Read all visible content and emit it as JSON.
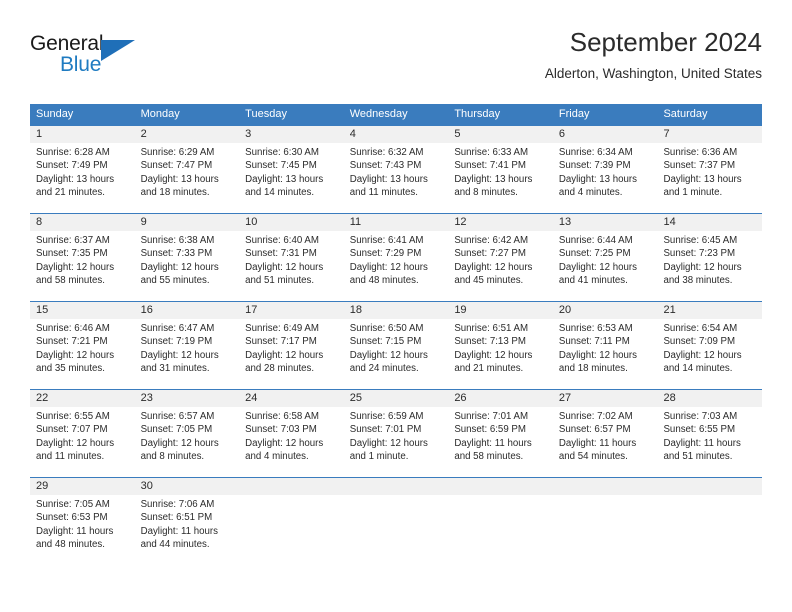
{
  "brand": {
    "name_part1": "General",
    "name_part2": "Blue",
    "flag_icon": "blue-triangle-flag-icon",
    "accent_color": "#1f6fb8"
  },
  "header": {
    "title": "September 2024",
    "location": "Alderton, Washington, United States"
  },
  "theme": {
    "header_blue": "#3a7cbe",
    "daynum_band": "#f1f1f1",
    "text": "#2b2b2b"
  },
  "calendar": {
    "weekdays": [
      "Sunday",
      "Monday",
      "Tuesday",
      "Wednesday",
      "Thursday",
      "Friday",
      "Saturday"
    ],
    "weeks": [
      [
        {
          "day": "1",
          "sunrise": "Sunrise: 6:28 AM",
          "sunset": "Sunset: 7:49 PM",
          "daylight1": "Daylight: 13 hours",
          "daylight2": "and 21 minutes."
        },
        {
          "day": "2",
          "sunrise": "Sunrise: 6:29 AM",
          "sunset": "Sunset: 7:47 PM",
          "daylight1": "Daylight: 13 hours",
          "daylight2": "and 18 minutes."
        },
        {
          "day": "3",
          "sunrise": "Sunrise: 6:30 AM",
          "sunset": "Sunset: 7:45 PM",
          "daylight1": "Daylight: 13 hours",
          "daylight2": "and 14 minutes."
        },
        {
          "day": "4",
          "sunrise": "Sunrise: 6:32 AM",
          "sunset": "Sunset: 7:43 PM",
          "daylight1": "Daylight: 13 hours",
          "daylight2": "and 11 minutes."
        },
        {
          "day": "5",
          "sunrise": "Sunrise: 6:33 AM",
          "sunset": "Sunset: 7:41 PM",
          "daylight1": "Daylight: 13 hours",
          "daylight2": "and 8 minutes."
        },
        {
          "day": "6",
          "sunrise": "Sunrise: 6:34 AM",
          "sunset": "Sunset: 7:39 PM",
          "daylight1": "Daylight: 13 hours",
          "daylight2": "and 4 minutes."
        },
        {
          "day": "7",
          "sunrise": "Sunrise: 6:36 AM",
          "sunset": "Sunset: 7:37 PM",
          "daylight1": "Daylight: 13 hours",
          "daylight2": "and 1 minute."
        }
      ],
      [
        {
          "day": "8",
          "sunrise": "Sunrise: 6:37 AM",
          "sunset": "Sunset: 7:35 PM",
          "daylight1": "Daylight: 12 hours",
          "daylight2": "and 58 minutes."
        },
        {
          "day": "9",
          "sunrise": "Sunrise: 6:38 AM",
          "sunset": "Sunset: 7:33 PM",
          "daylight1": "Daylight: 12 hours",
          "daylight2": "and 55 minutes."
        },
        {
          "day": "10",
          "sunrise": "Sunrise: 6:40 AM",
          "sunset": "Sunset: 7:31 PM",
          "daylight1": "Daylight: 12 hours",
          "daylight2": "and 51 minutes."
        },
        {
          "day": "11",
          "sunrise": "Sunrise: 6:41 AM",
          "sunset": "Sunset: 7:29 PM",
          "daylight1": "Daylight: 12 hours",
          "daylight2": "and 48 minutes."
        },
        {
          "day": "12",
          "sunrise": "Sunrise: 6:42 AM",
          "sunset": "Sunset: 7:27 PM",
          "daylight1": "Daylight: 12 hours",
          "daylight2": "and 45 minutes."
        },
        {
          "day": "13",
          "sunrise": "Sunrise: 6:44 AM",
          "sunset": "Sunset: 7:25 PM",
          "daylight1": "Daylight: 12 hours",
          "daylight2": "and 41 minutes."
        },
        {
          "day": "14",
          "sunrise": "Sunrise: 6:45 AM",
          "sunset": "Sunset: 7:23 PM",
          "daylight1": "Daylight: 12 hours",
          "daylight2": "and 38 minutes."
        }
      ],
      [
        {
          "day": "15",
          "sunrise": "Sunrise: 6:46 AM",
          "sunset": "Sunset: 7:21 PM",
          "daylight1": "Daylight: 12 hours",
          "daylight2": "and 35 minutes."
        },
        {
          "day": "16",
          "sunrise": "Sunrise: 6:47 AM",
          "sunset": "Sunset: 7:19 PM",
          "daylight1": "Daylight: 12 hours",
          "daylight2": "and 31 minutes."
        },
        {
          "day": "17",
          "sunrise": "Sunrise: 6:49 AM",
          "sunset": "Sunset: 7:17 PM",
          "daylight1": "Daylight: 12 hours",
          "daylight2": "and 28 minutes."
        },
        {
          "day": "18",
          "sunrise": "Sunrise: 6:50 AM",
          "sunset": "Sunset: 7:15 PM",
          "daylight1": "Daylight: 12 hours",
          "daylight2": "and 24 minutes."
        },
        {
          "day": "19",
          "sunrise": "Sunrise: 6:51 AM",
          "sunset": "Sunset: 7:13 PM",
          "daylight1": "Daylight: 12 hours",
          "daylight2": "and 21 minutes."
        },
        {
          "day": "20",
          "sunrise": "Sunrise: 6:53 AM",
          "sunset": "Sunset: 7:11 PM",
          "daylight1": "Daylight: 12 hours",
          "daylight2": "and 18 minutes."
        },
        {
          "day": "21",
          "sunrise": "Sunrise: 6:54 AM",
          "sunset": "Sunset: 7:09 PM",
          "daylight1": "Daylight: 12 hours",
          "daylight2": "and 14 minutes."
        }
      ],
      [
        {
          "day": "22",
          "sunrise": "Sunrise: 6:55 AM",
          "sunset": "Sunset: 7:07 PM",
          "daylight1": "Daylight: 12 hours",
          "daylight2": "and 11 minutes."
        },
        {
          "day": "23",
          "sunrise": "Sunrise: 6:57 AM",
          "sunset": "Sunset: 7:05 PM",
          "daylight1": "Daylight: 12 hours",
          "daylight2": "and 8 minutes."
        },
        {
          "day": "24",
          "sunrise": "Sunrise: 6:58 AM",
          "sunset": "Sunset: 7:03 PM",
          "daylight1": "Daylight: 12 hours",
          "daylight2": "and 4 minutes."
        },
        {
          "day": "25",
          "sunrise": "Sunrise: 6:59 AM",
          "sunset": "Sunset: 7:01 PM",
          "daylight1": "Daylight: 12 hours",
          "daylight2": "and 1 minute."
        },
        {
          "day": "26",
          "sunrise": "Sunrise: 7:01 AM",
          "sunset": "Sunset: 6:59 PM",
          "daylight1": "Daylight: 11 hours",
          "daylight2": "and 58 minutes."
        },
        {
          "day": "27",
          "sunrise": "Sunrise: 7:02 AM",
          "sunset": "Sunset: 6:57 PM",
          "daylight1": "Daylight: 11 hours",
          "daylight2": "and 54 minutes."
        },
        {
          "day": "28",
          "sunrise": "Sunrise: 7:03 AM",
          "sunset": "Sunset: 6:55 PM",
          "daylight1": "Daylight: 11 hours",
          "daylight2": "and 51 minutes."
        }
      ],
      [
        {
          "day": "29",
          "sunrise": "Sunrise: 7:05 AM",
          "sunset": "Sunset: 6:53 PM",
          "daylight1": "Daylight: 11 hours",
          "daylight2": "and 48 minutes."
        },
        {
          "day": "30",
          "sunrise": "Sunrise: 7:06 AM",
          "sunset": "Sunset: 6:51 PM",
          "daylight1": "Daylight: 11 hours",
          "daylight2": "and 44 minutes."
        },
        {
          "day": "",
          "sunrise": "",
          "sunset": "",
          "daylight1": "",
          "daylight2": ""
        },
        {
          "day": "",
          "sunrise": "",
          "sunset": "",
          "daylight1": "",
          "daylight2": ""
        },
        {
          "day": "",
          "sunrise": "",
          "sunset": "",
          "daylight1": "",
          "daylight2": ""
        },
        {
          "day": "",
          "sunrise": "",
          "sunset": "",
          "daylight1": "",
          "daylight2": ""
        },
        {
          "day": "",
          "sunrise": "",
          "sunset": "",
          "daylight1": "",
          "daylight2": ""
        }
      ]
    ]
  }
}
